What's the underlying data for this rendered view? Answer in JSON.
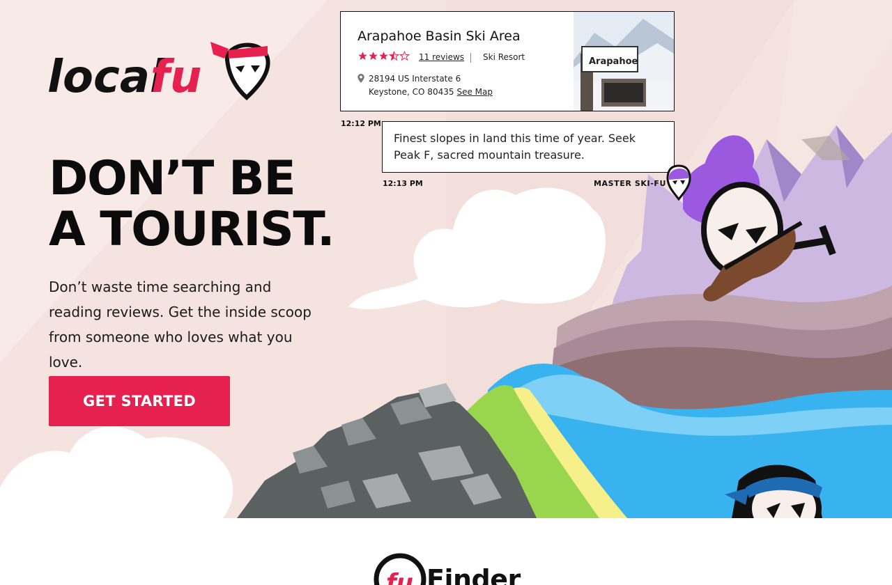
{
  "brand": {
    "name_part1": "local",
    "name_part2": "fu",
    "accent_color": "#e6214f"
  },
  "hero": {
    "headline_line1": "DON’T BE",
    "headline_line2": "A TOURIST.",
    "subtext": "Don’t waste time searching and reading reviews. Get the inside scoop from someone who loves what you love.",
    "cta_label": "GET STARTED"
  },
  "place_card": {
    "name": "Arapahoe Basin Ski Area",
    "rating": 3.5,
    "reviews_label": "11 reviews",
    "category": "Ski Resort",
    "address_line1": "28194 US Interstate 6",
    "address_line2": "Keystone, CO 80435",
    "see_map_label": "See Map",
    "photo_sign_text": "Arapahoe",
    "time": "12:12 PM"
  },
  "chat": {
    "message": "Finest slopes in land this time of year. Seek Peak F, sacred mountain treasure.",
    "time": "12:13 PM",
    "sender": "MASTER SKI-FU"
  },
  "finder": {
    "logo_text": "fu",
    "title": "Finder"
  },
  "icons": {
    "star": "star-icon",
    "location": "map-pin-icon",
    "mascot": "ninja-mascot-icon"
  }
}
